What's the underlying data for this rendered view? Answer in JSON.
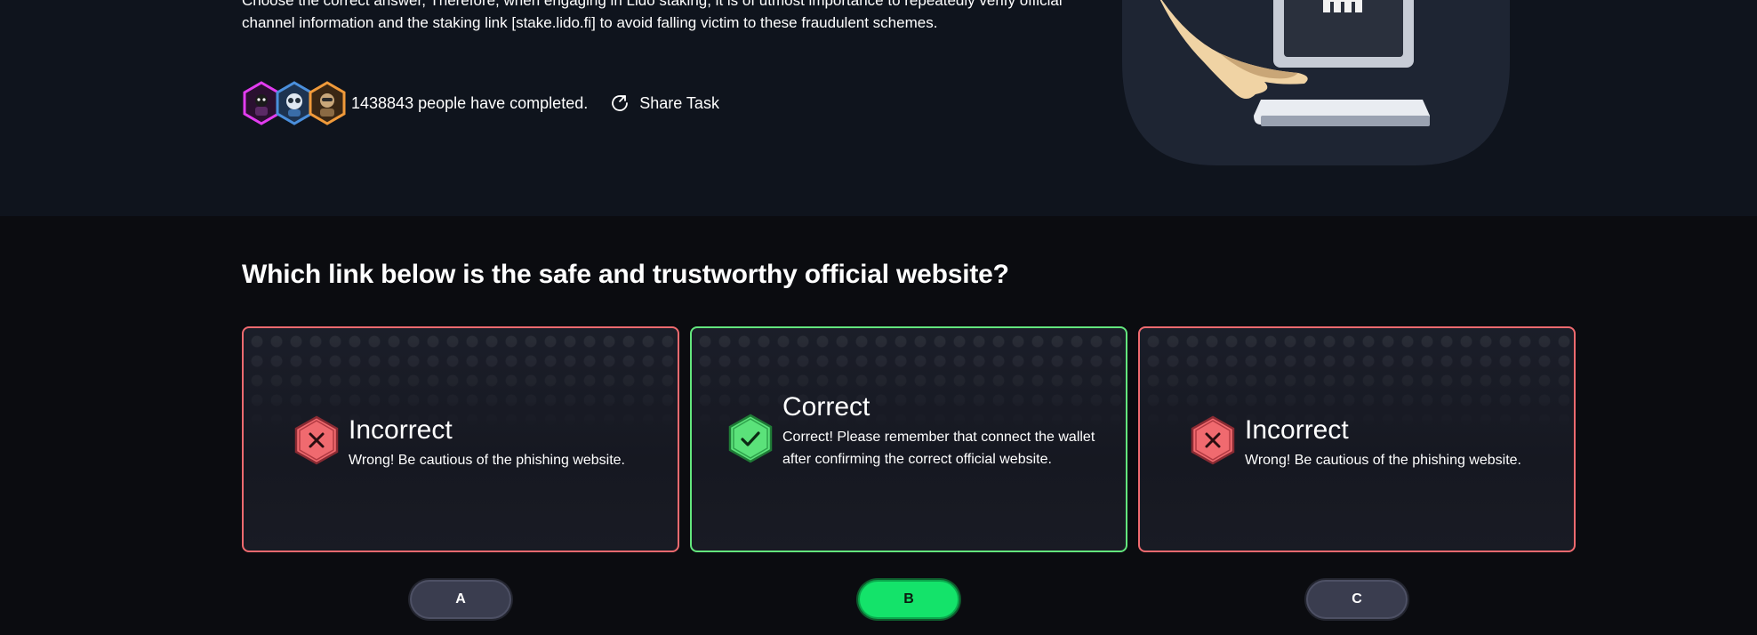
{
  "intro": {
    "description": "Choose the correct answer, Therefore, when engaging in Lido staking, it is of utmost importance to repeatedly verify official channel information and the staking link [stake.lido.fi] to avoid falling victim to these fraudulent schemes."
  },
  "stats": {
    "completed_text": "1438843 people have completed.",
    "share_label": "Share Task",
    "avatar_colors": [
      "#e23cf0",
      "#4a8fdc",
      "#f09a3a"
    ]
  },
  "quiz": {
    "question": "Which link below is the safe and trustworthy official website?",
    "options": [
      {
        "letter": "A",
        "status": "Incorrect",
        "message": "Wrong! Be cautious of the phishing website.",
        "correct": false
      },
      {
        "letter": "B",
        "status": "Correct",
        "message": "Correct! Please remember that connect the wallet after confirming the correct official website.",
        "correct": true
      },
      {
        "letter": "C",
        "status": "Incorrect",
        "message": "Wrong! Be cautious of the phishing website.",
        "correct": false
      }
    ]
  },
  "colors": {
    "incorrect": "#f06a6f",
    "correct": "#63e67d",
    "selected_pill": "#14e36a",
    "pill": "#3a3d4f"
  }
}
